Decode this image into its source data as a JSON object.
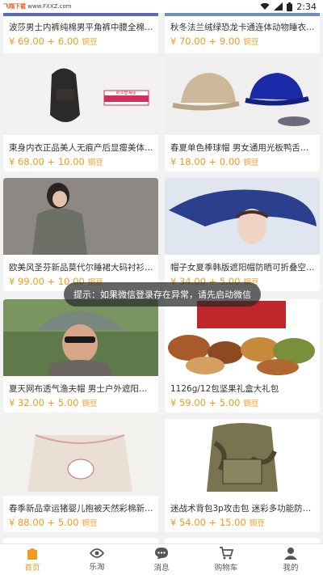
{
  "status_bar": {
    "watermark_left": "飞翔下载",
    "watermark_right": "www.FXXZ.com",
    "time": "2:34"
  },
  "toast": "提示：如果微信登录存在异常，请先启动微信",
  "products": [
    {
      "title": "波莎男士内裤纯棉男平角裤中腰全棉短裤...",
      "price": "¥ 69.00 + 6.00",
      "unit": "铜豆"
    },
    {
      "title": "秋冬法兰绒绿恐龙卡通连体动物睡衣皮卡...",
      "price": "¥ 70.00 + 9.00",
      "unit": "铜豆"
    },
    {
      "title": "束身内衣正品美人无痕产后显瘦美体束塑...",
      "price": "¥ 68.00 + 10.00",
      "unit": "铜豆",
      "img_text": "斯享登海店"
    },
    {
      "title": "春夏单色棒球帽 男女通用光板鸭舌帽子",
      "price": "¥ 18.00 + 0.00",
      "unit": "铜豆"
    },
    {
      "title": "欧美风圣芬新品莫代尔睡裙大码衬衫裙女...",
      "price": "¥ 99.00 + 10.00",
      "unit": "铜豆"
    },
    {
      "title": "帽子女夏季韩版遮阳帽防晒可折叠空顶帽...",
      "price": "¥ 34.00 + 5.00",
      "unit": "铜豆"
    },
    {
      "title": "夏天网布透气渔夫帽 男士户外遮阳帽 韩版...",
      "price": "¥ 32.00 + 5.00",
      "unit": "铜豆"
    },
    {
      "title": "1126g/12包坚果礼盒大礼包",
      "price": "¥ 59.00 + 5.00",
      "unit": "铜豆"
    },
    {
      "title": "春季新品幸运猪婴儿抱被天然彩棉新生儿...",
      "price": "¥ 88.00 + 5.00",
      "unit": "铜豆"
    },
    {
      "title": "迷战术背包3p攻击包 迷彩多功能防水背包...",
      "price": "¥ 54.00 + 15.00",
      "unit": "铜豆"
    }
  ],
  "tabs": [
    {
      "label": "首页",
      "icon": "home-icon"
    },
    {
      "label": "乐淘",
      "icon": "eye-icon"
    },
    {
      "label": "消息",
      "icon": "message-icon"
    },
    {
      "label": "购物车",
      "icon": "cart-icon"
    },
    {
      "label": "我的",
      "icon": "user-icon"
    }
  ],
  "colors": {
    "accent": "#f29a1d",
    "toast_bg": "#3a3a3a"
  }
}
